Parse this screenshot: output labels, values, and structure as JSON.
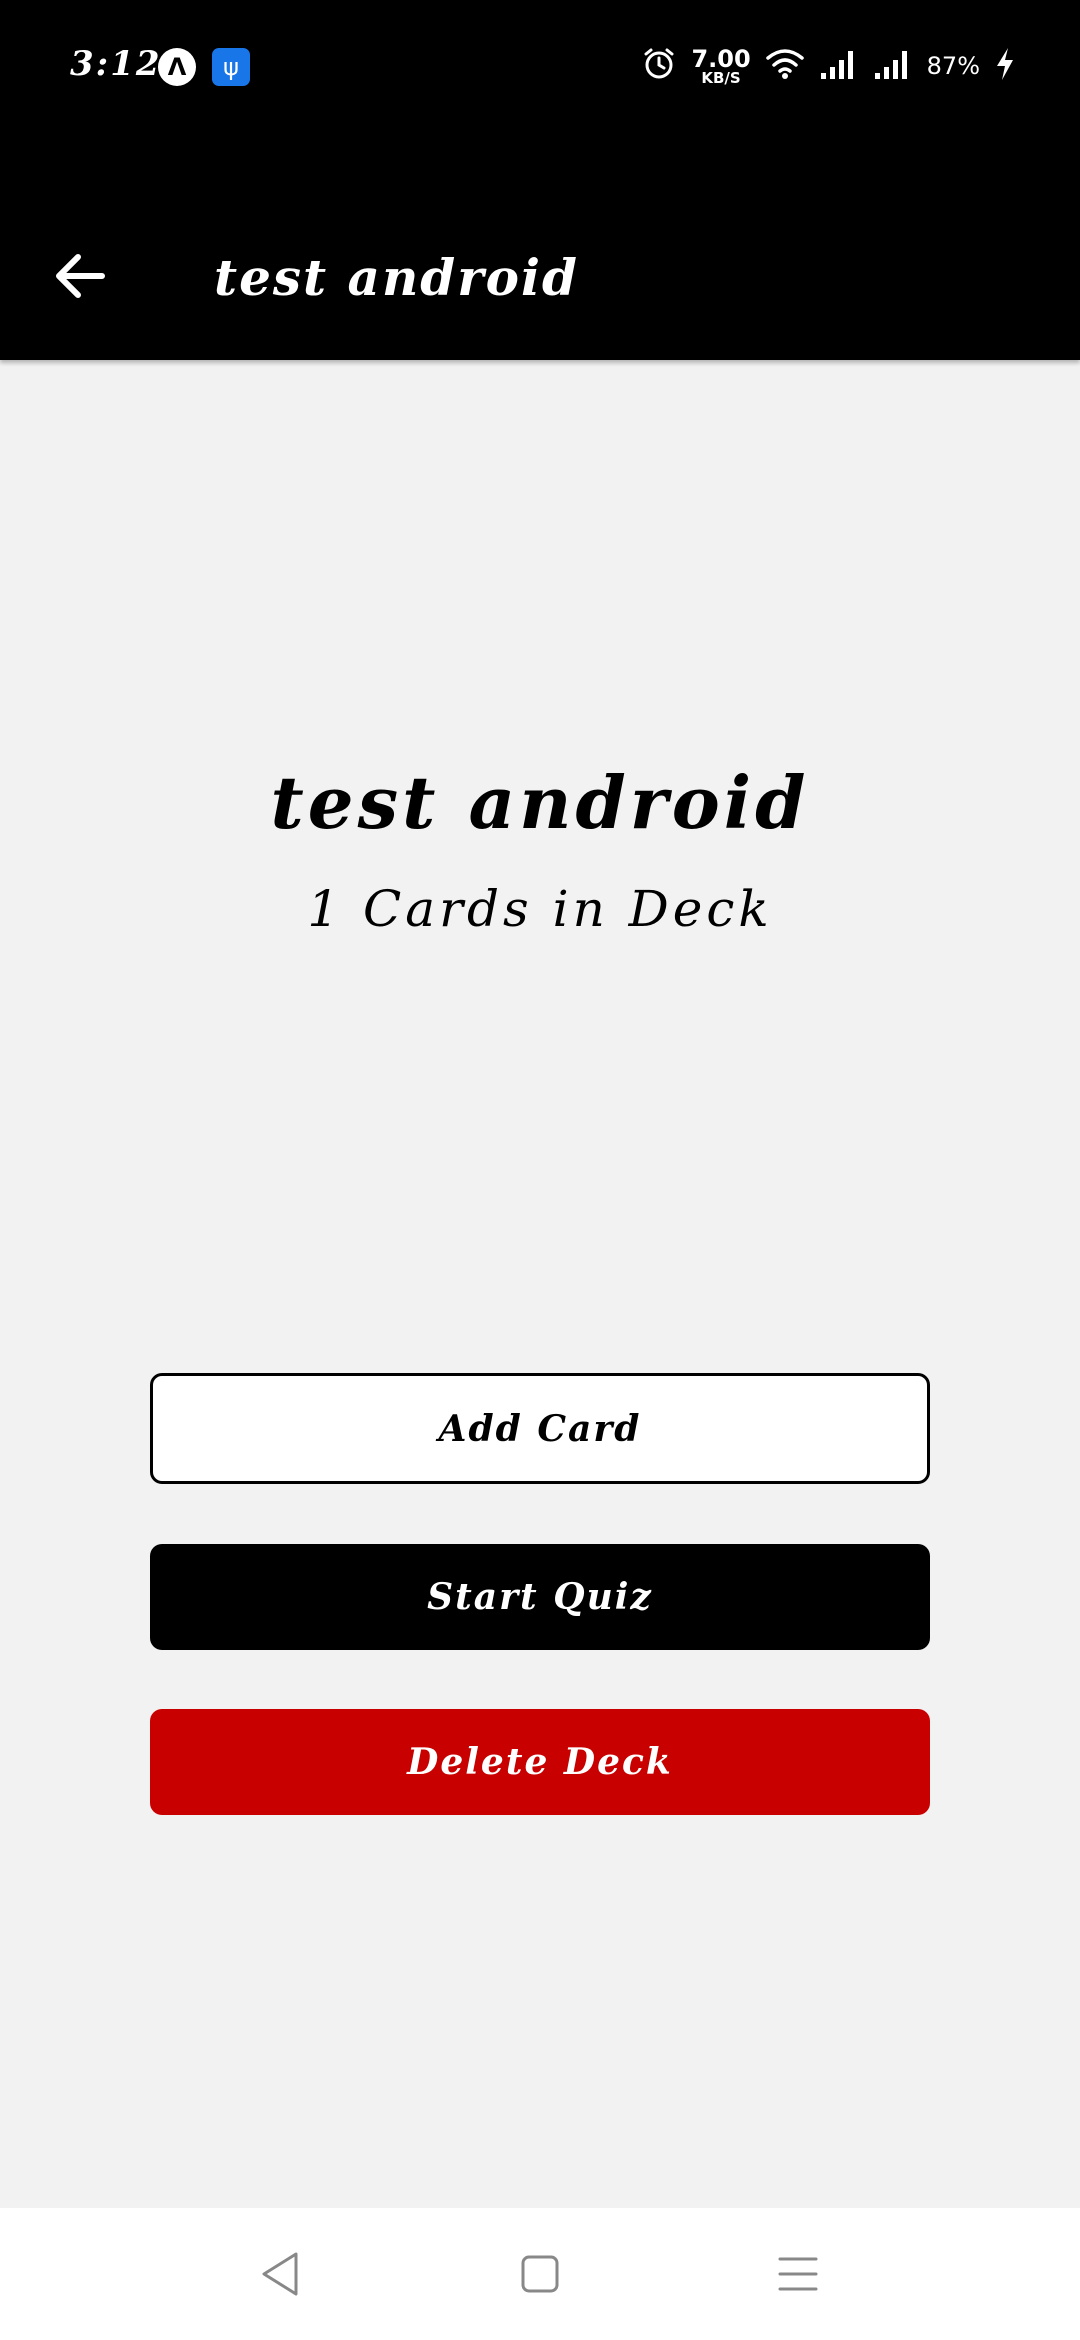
{
  "status_bar": {
    "time": "3:12",
    "network_speed_value": "7.00",
    "network_speed_unit": "KB/S",
    "battery": "87%",
    "icons": [
      "expo-icon",
      "usb-debug-icon",
      "alarm-icon",
      "wifi-icon",
      "signal-icon",
      "signal-icon",
      "charging-icon"
    ]
  },
  "app_bar": {
    "title": "test android",
    "back_icon": "arrow-left-icon"
  },
  "deck": {
    "title": "test android",
    "count_text": "1 Cards in Deck"
  },
  "actions": {
    "add_card": "Add Card",
    "start_quiz": "Start Quiz",
    "delete_deck": "Delete Deck"
  },
  "nav_bar": {
    "icons": [
      "back-triangle-icon",
      "home-square-icon",
      "recents-menu-icon"
    ]
  },
  "colors": {
    "app_bar": "#000000",
    "background": "#f2f2f2",
    "delete": "#c80000",
    "status_usb": "#1976e8"
  }
}
